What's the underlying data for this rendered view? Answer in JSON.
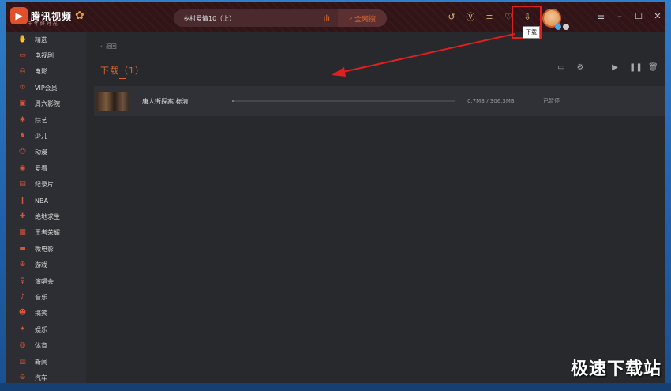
{
  "app": {
    "logo_text": "腾讯视频",
    "logo_sub": "千 年 好 时 光",
    "accent": "#e0662a",
    "highlight_color": "#e02020"
  },
  "search": {
    "value": "乡村爱情10（上）",
    "button_label": "全网搜"
  },
  "top_icons": [
    "history-icon",
    "vip-icon",
    "playlist-icon",
    "favorite-icon",
    "download-icon"
  ],
  "tooltip": "下载",
  "sidebar": {
    "items": [
      {
        "label": "精选",
        "icon": "star-hand-icon"
      },
      {
        "label": "电视剧",
        "icon": "tv-icon"
      },
      {
        "label": "电影",
        "icon": "film-reel-icon"
      },
      {
        "label": "VIP会员",
        "icon": "vip-icon"
      },
      {
        "label": "周六影院",
        "icon": "cinema-icon"
      },
      {
        "label": "综艺",
        "icon": "variety-icon"
      },
      {
        "label": "少儿",
        "icon": "horse-icon"
      },
      {
        "label": "动漫",
        "icon": "anime-icon"
      },
      {
        "label": "爱看",
        "icon": "eye-icon"
      },
      {
        "label": "纪录片",
        "icon": "documentary-icon"
      },
      {
        "label": "NBA",
        "icon": "nba-icon"
      },
      {
        "label": "绝地求生",
        "icon": "game-pubg-icon"
      },
      {
        "label": "王者荣耀",
        "icon": "game-hok-icon"
      },
      {
        "label": "微电影",
        "icon": "micro-film-icon"
      },
      {
        "label": "游戏",
        "icon": "gamepad-icon"
      },
      {
        "label": "演唱会",
        "icon": "microphone-icon"
      },
      {
        "label": "音乐",
        "icon": "music-icon"
      },
      {
        "label": "搞笑",
        "icon": "smile-icon"
      },
      {
        "label": "娱乐",
        "icon": "entertainment-icon"
      },
      {
        "label": "体育",
        "icon": "sports-icon"
      },
      {
        "label": "新闻",
        "icon": "news-icon"
      },
      {
        "label": "汽车",
        "icon": "car-icon"
      }
    ]
  },
  "main": {
    "back_label": "返回",
    "title": "下载（1）",
    "downloads": [
      {
        "name": "唐人街探案 标清",
        "size": "0.7MB / 306.3MB",
        "status": "已暂停",
        "progress": 0.0023
      }
    ]
  },
  "watermark": "极速下载站"
}
